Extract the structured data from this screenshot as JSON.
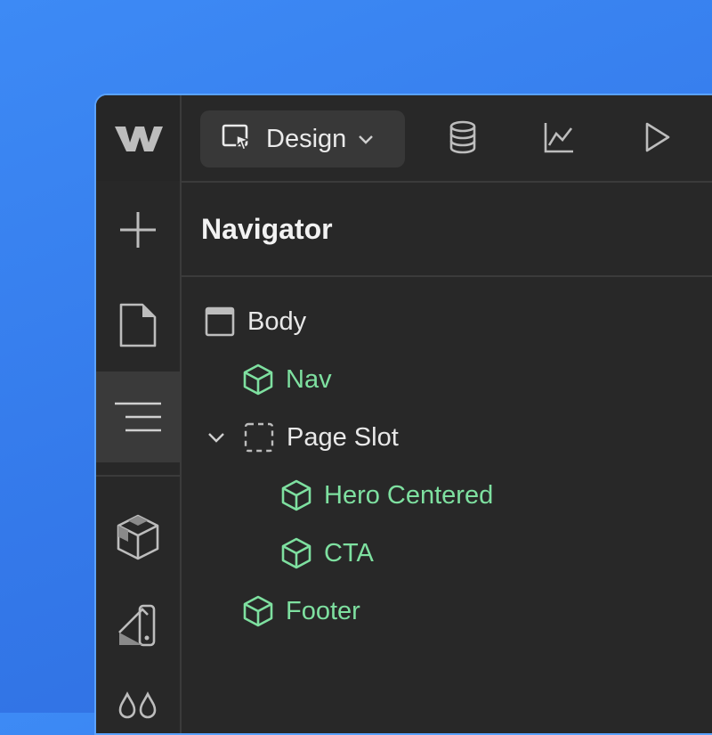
{
  "colors": {
    "background": "#3479ea",
    "panel": "#282828",
    "component_green": "#7ee0a0",
    "text_white": "#e8e8e8"
  },
  "topbar": {
    "logo": "webflow-logo",
    "mode_label": "Design",
    "icons": [
      "cms-database-icon",
      "analytics-chart-icon",
      "preview-play-icon"
    ]
  },
  "sidebar": {
    "items": [
      {
        "icon": "add-plus-icon",
        "active": false
      },
      {
        "icon": "pages-icon",
        "active": false
      },
      {
        "icon": "navigator-icon",
        "active": true
      },
      {
        "icon": "components-icon",
        "active": false
      },
      {
        "icon": "style-selectors-icon",
        "active": false
      },
      {
        "icon": "variables-drops-icon",
        "active": false
      }
    ]
  },
  "navigator": {
    "title": "Navigator",
    "tree": [
      {
        "label": "Body",
        "type": "body",
        "depth": 0
      },
      {
        "label": "Nav",
        "type": "component",
        "depth": 1
      },
      {
        "label": "Page Slot",
        "type": "slot",
        "depth": 1,
        "expanded": true
      },
      {
        "label": "Hero Centered",
        "type": "component",
        "depth": 2
      },
      {
        "label": "CTA",
        "type": "component",
        "depth": 2
      },
      {
        "label": "Footer",
        "type": "component",
        "depth": 1
      }
    ]
  }
}
